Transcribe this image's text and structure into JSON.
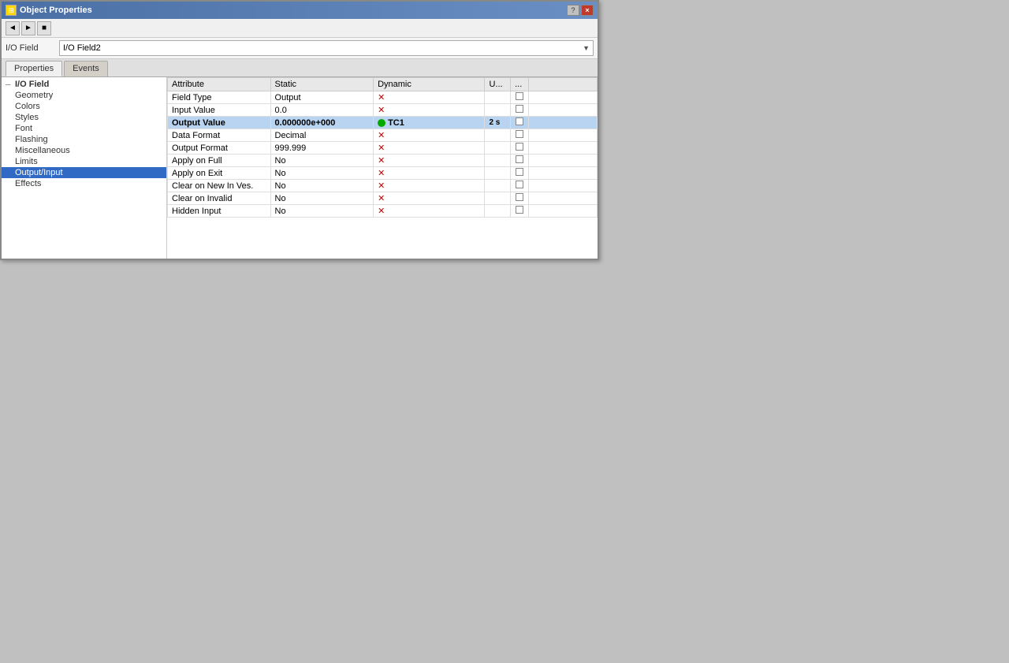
{
  "window": {
    "title": "Object Properties",
    "help_label": "?",
    "close_label": "×"
  },
  "toolbar": {
    "buttons": [
      {
        "label": "◄",
        "name": "btn1"
      },
      {
        "label": "►",
        "name": "btn2"
      },
      {
        "label": "■",
        "name": "btn3"
      }
    ]
  },
  "field_selector": {
    "label1": "I/O Field",
    "label2": "I/O Field2"
  },
  "tabs": [
    {
      "label": "Properties",
      "active": true
    },
    {
      "label": "Events",
      "active": false
    }
  ],
  "tree": {
    "root": {
      "label": "I/O Field",
      "expanded": true
    },
    "items": [
      {
        "label": "Geometry",
        "indent": 1,
        "selected": false
      },
      {
        "label": "Colors",
        "indent": 1,
        "selected": false
      },
      {
        "label": "Styles",
        "indent": 1,
        "selected": false
      },
      {
        "label": "Font",
        "indent": 1,
        "selected": false
      },
      {
        "label": "Flashing",
        "indent": 1,
        "selected": false
      },
      {
        "label": "Miscellaneous",
        "indent": 1,
        "selected": false
      },
      {
        "label": "Limits",
        "indent": 1,
        "selected": false
      },
      {
        "label": "Output/Input",
        "indent": 1,
        "selected": true
      },
      {
        "label": "Effects",
        "indent": 1,
        "selected": false
      }
    ]
  },
  "table": {
    "headers": [
      "Attribute",
      "Static",
      "Dynamic",
      "U...",
      "..."
    ],
    "rows": [
      {
        "attribute": "Field Type",
        "static": "Output",
        "dynamic": "",
        "u": "",
        "dots": "",
        "has_x": true,
        "x_type": "normal",
        "has_dot": false,
        "highlighted": false
      },
      {
        "attribute": "Input Value",
        "static": "0.0",
        "dynamic": "",
        "u": "",
        "dots": "",
        "has_x": true,
        "x_type": "normal",
        "has_dot": false,
        "highlighted": false
      },
      {
        "attribute": "Output Value",
        "static": "0.000000e+000",
        "dynamic": "TC1",
        "u": "2 s",
        "dots": "",
        "has_x": true,
        "x_type": "normal",
        "has_dot": true,
        "highlighted": true
      },
      {
        "attribute": "Data Format",
        "static": "Decimal",
        "dynamic": "",
        "u": "",
        "dots": "",
        "has_x": true,
        "x_type": "normal",
        "has_dot": false,
        "highlighted": false
      },
      {
        "attribute": "Output Format",
        "static": "999.999",
        "dynamic": "",
        "u": "",
        "dots": "",
        "has_x": true,
        "x_type": "normal",
        "has_dot": false,
        "highlighted": false
      },
      {
        "attribute": "Apply on Full",
        "static": "No",
        "dynamic": "",
        "u": "",
        "dots": "",
        "has_x": true,
        "x_type": "normal",
        "has_dot": false,
        "highlighted": false
      },
      {
        "attribute": "Apply on Exit",
        "static": "No",
        "dynamic": "",
        "u": "",
        "dots": "",
        "has_x": true,
        "x_type": "normal",
        "has_dot": false,
        "highlighted": false
      },
      {
        "attribute": "Clear on New In Ves.",
        "static": "No",
        "dynamic": "",
        "u": "",
        "dots": "",
        "has_x": true,
        "x_type": "normal",
        "has_dot": false,
        "highlighted": false
      },
      {
        "attribute": "Clear on Invalid",
        "static": "No",
        "dynamic": "",
        "u": "",
        "dots": "",
        "has_x": true,
        "x_type": "normal",
        "has_dot": false,
        "highlighted": false
      },
      {
        "attribute": "Hidden Input",
        "static": "No",
        "dynamic": "",
        "u": "",
        "dots": "",
        "has_x": true,
        "x_type": "normal",
        "has_dot": false,
        "highlighted": false
      }
    ]
  }
}
